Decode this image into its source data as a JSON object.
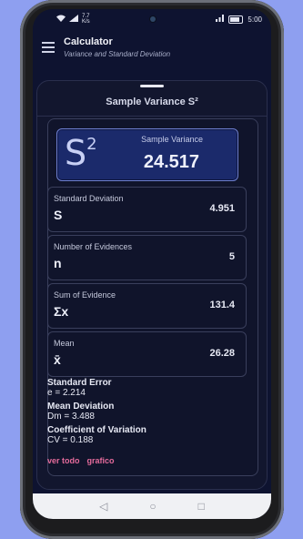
{
  "status_bar": {
    "speed_value": "7.7",
    "speed_unit": "K/s",
    "time": "5:00"
  },
  "app_bar": {
    "title": "Calculator",
    "subtitle": "Variance and Standard Deviation"
  },
  "sheet": {
    "title": "Sample Variance S²"
  },
  "hero": {
    "symbol": "S",
    "exponent": "2",
    "label": "Sample Variance",
    "value": "24.517"
  },
  "stats": [
    {
      "label": "Standard Deviation",
      "symbol": "S",
      "value": "4.951"
    },
    {
      "label": "Number of Evidences",
      "symbol": "n",
      "value": "5"
    },
    {
      "label": "Sum of Evidence",
      "symbol": "Σx",
      "value": "131.4"
    },
    {
      "label": "Mean",
      "symbol": "x̄",
      "value": "26.28"
    }
  ],
  "extras": [
    {
      "heading": "Standard Error",
      "formula": "e = 2.214"
    },
    {
      "heading": "Mean Deviation",
      "formula": "Dm = 3.488"
    },
    {
      "heading": "Coefficient of Variation",
      "formula": "CV = 0.188"
    }
  ],
  "links": {
    "see_all": "ver todo",
    "chart": "grafico"
  },
  "nav": {
    "back": "◁",
    "home": "○",
    "recent": "□"
  },
  "colors": {
    "background": "#8e9ff0",
    "screen": "#0e1330",
    "accent_link": "#e46b9b",
    "hero_fill": "#1b2a6b"
  }
}
